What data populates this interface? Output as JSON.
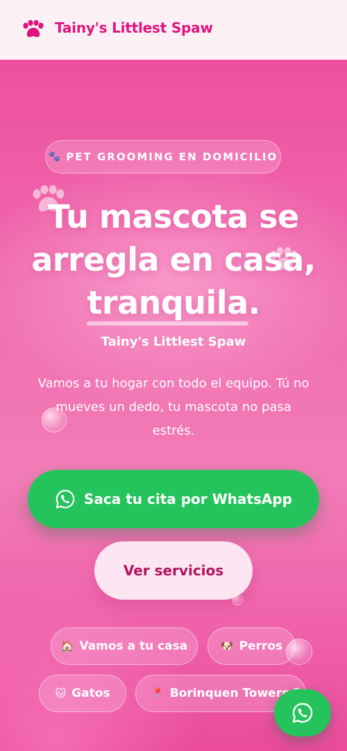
{
  "header": {
    "brand_name": "Tainy's Littlest Spaw",
    "logo_icon": "paw-icon",
    "brand_color": "#e0137e"
  },
  "hero": {
    "badge": {
      "icon": "🐾",
      "label": "PET GROOMING EN DOMICILIO"
    },
    "headline": {
      "line1": "Tu mascota se",
      "line2": "arregla en casa,",
      "line3_word": "tranquila",
      "line3_punct": "."
    },
    "subbrand": "Tainy's Littlest Spaw",
    "description": "Vamos a tu hogar con todo el equipo. Tú no mueves un dedo, tu mascota no pasa estrés.",
    "cta_whatsapp": {
      "label": "Saca tu cita por WhatsApp",
      "icon": "whatsapp-icon",
      "color": "#25c35b"
    },
    "cta_services": {
      "label": "Ver servicios"
    },
    "chips": [
      {
        "emoji": "🏠",
        "label": "Vamos a tu casa"
      },
      {
        "emoji": "🐶",
        "label": "Perros"
      },
      {
        "emoji": "🐱",
        "label": "Gatos"
      },
      {
        "emoji": "📍",
        "label": "Borinquen Towers 3"
      }
    ]
  },
  "floating_button": {
    "icon": "whatsapp-icon"
  }
}
